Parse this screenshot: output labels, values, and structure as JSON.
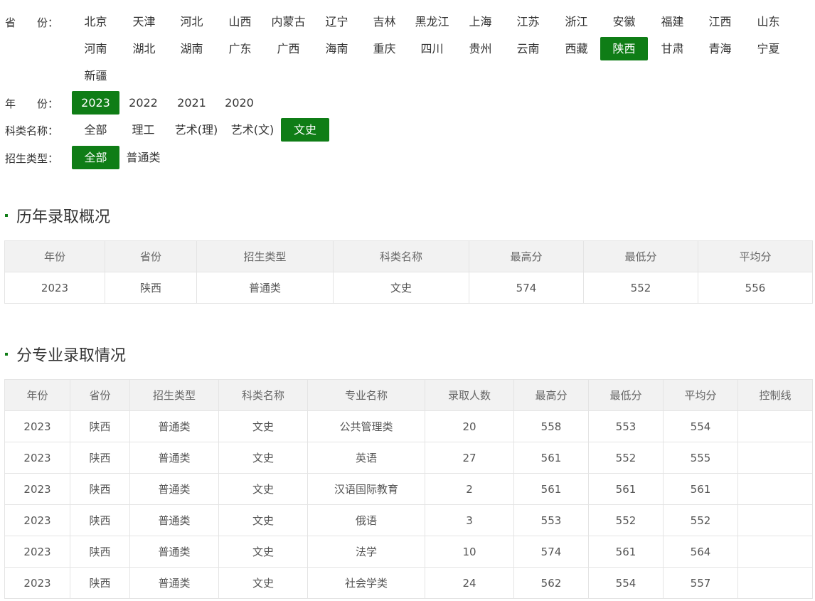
{
  "filters": {
    "province": {
      "label": "省　　份：",
      "items": [
        "北京",
        "天津",
        "河北",
        "山西",
        "内蒙古",
        "辽宁",
        "吉林",
        "黑龙江",
        "上海",
        "江苏",
        "浙江",
        "安徽",
        "福建",
        "江西",
        "山东",
        "河南",
        "湖北",
        "湖南",
        "广东",
        "广西",
        "海南",
        "重庆",
        "四川",
        "贵州",
        "云南",
        "西藏",
        "陕西",
        "甘肃",
        "青海",
        "宁夏",
        "新疆"
      ],
      "selected": "陕西"
    },
    "year": {
      "label": "年　　份：",
      "items": [
        "2023",
        "2022",
        "2021",
        "2020"
      ],
      "selected": "2023"
    },
    "subject": {
      "label": "科类名称：",
      "items": [
        "全部",
        "理工",
        "艺术(理)",
        "艺术(文)",
        "文史"
      ],
      "selected": "文史"
    },
    "type": {
      "label": "招生类型：",
      "items": [
        "全部",
        "普通类"
      ],
      "selected": "全部"
    }
  },
  "section1": {
    "title": "历年录取概况",
    "headers": [
      "年份",
      "省份",
      "招生类型",
      "科类名称",
      "最高分",
      "最低分",
      "平均分"
    ],
    "rows": [
      [
        "2023",
        "陕西",
        "普通类",
        "文史",
        "574",
        "552",
        "556"
      ]
    ]
  },
  "section2": {
    "title": "分专业录取情况",
    "headers": [
      "年份",
      "省份",
      "招生类型",
      "科类名称",
      "专业名称",
      "录取人数",
      "最高分",
      "最低分",
      "平均分",
      "控制线"
    ],
    "rows": [
      [
        "2023",
        "陕西",
        "普通类",
        "文史",
        "公共管理类",
        "20",
        "558",
        "553",
        "554",
        ""
      ],
      [
        "2023",
        "陕西",
        "普通类",
        "文史",
        "英语",
        "27",
        "561",
        "552",
        "555",
        ""
      ],
      [
        "2023",
        "陕西",
        "普通类",
        "文史",
        "汉语国际教育",
        "2",
        "561",
        "561",
        "561",
        ""
      ],
      [
        "2023",
        "陕西",
        "普通类",
        "文史",
        "俄语",
        "3",
        "553",
        "552",
        "552",
        ""
      ],
      [
        "2023",
        "陕西",
        "普通类",
        "文史",
        "法学",
        "10",
        "574",
        "561",
        "564",
        ""
      ],
      [
        "2023",
        "陕西",
        "普通类",
        "文史",
        "社会学类",
        "24",
        "562",
        "554",
        "557",
        ""
      ]
    ]
  },
  "colors": {
    "accent": "#0f7d16",
    "header_bg": "#f2f2f2",
    "border": "#e4e4e4"
  }
}
